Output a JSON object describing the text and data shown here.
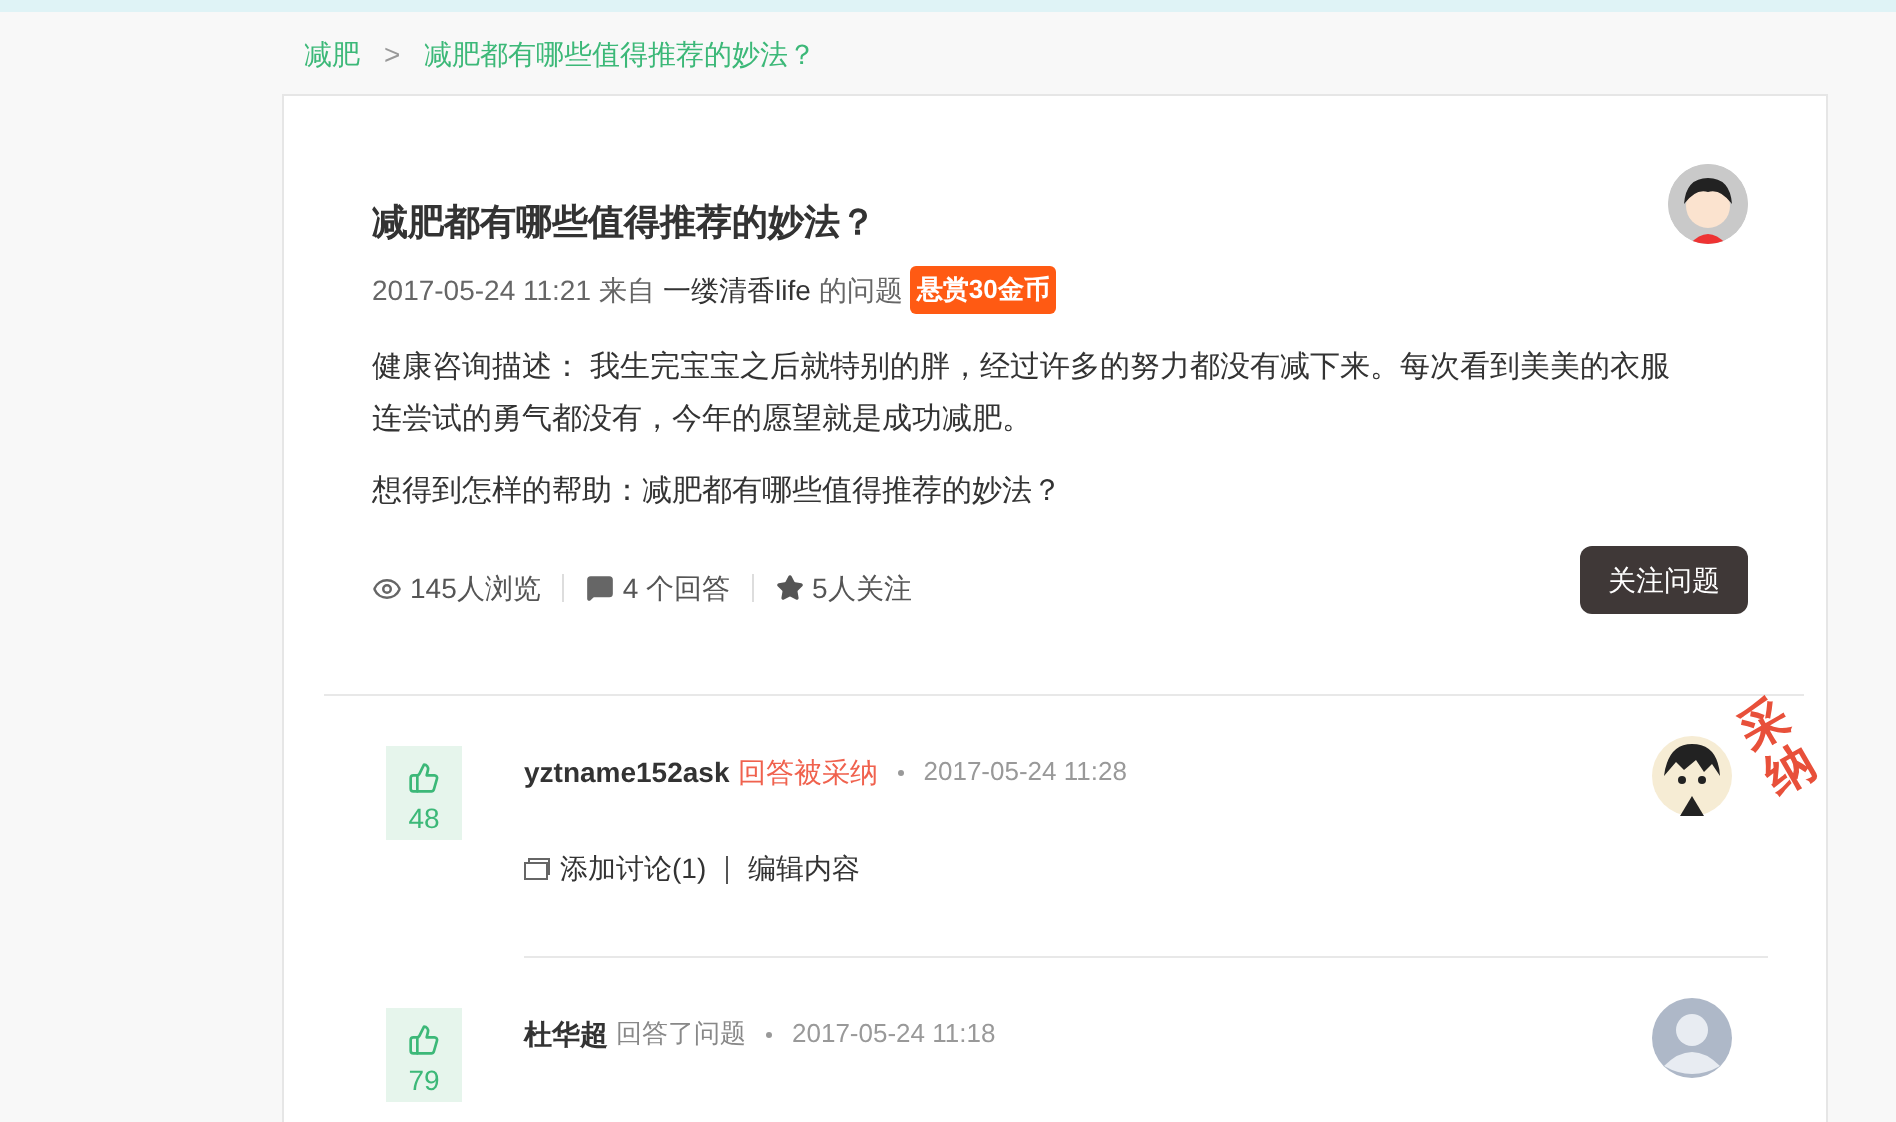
{
  "breadcrumb": [
    {
      "label": "减肥"
    },
    {
      "label": "减肥都有哪些值得推荐的妙法？"
    }
  ],
  "breadcrumb_separator": ">",
  "question": {
    "title": "减肥都有哪些值得推荐的妙法？",
    "time": "2017-05-24 11:21",
    "from_label": "来自",
    "author": "一缕清香life",
    "suffix": "的问题",
    "reward": "悬赏30金币",
    "description_label": "健康咨询描述：",
    "description": "我生完宝宝之后就特别的胖，经过许多的努力都没有减下来。每次看到美美的衣服连尝试的勇气都没有，今年的愿望就是成功减肥。",
    "help": "想得到怎样的帮助：减肥都有哪些值得推荐的妙法？",
    "stats": [
      {
        "kind": "views",
        "text": "145人浏览"
      },
      {
        "kind": "answers",
        "text": "4 个回答"
      },
      {
        "kind": "follows",
        "text": "5人关注"
      }
    ],
    "follow_button": "关注问题"
  },
  "answers": [
    {
      "votes": "48",
      "user": "yztname152ask",
      "action": "回答被采纳",
      "accepted": true,
      "time": "2017-05-24 11:28",
      "kind": "cartoon",
      "stamp": "采纳",
      "links": [
        {
          "kind": "discuss",
          "text": "添加讨论(1)"
        },
        {
          "kind": "edit",
          "text": "编辑内容"
        }
      ]
    },
    {
      "votes": "79",
      "user": "杜华超",
      "action": "回答了问题",
      "accepted": false,
      "time": "2017-05-24 11:18",
      "kind": "default"
    }
  ]
}
